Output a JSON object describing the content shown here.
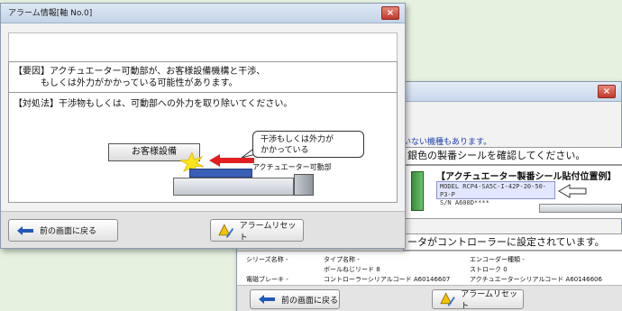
{
  "front": {
    "title": "アラーム情報[軸 No.0]",
    "close": "×",
    "cause_line1": "【要因】アクチュエーター可動部が、お客様設備機構と干渉、",
    "cause_line2": "もしくは外力がかかっている可能性があります。",
    "remedy": "【対処法】干渉物もしくは、可動部への外力を取り除いてください。",
    "equipment_label": "お客様設備",
    "callout_line1": "干渉もしくは外力が",
    "callout_line2": "かかっている",
    "actuator_label": "アクチュエーター可動部",
    "back_button": "前の画面に戻る",
    "reset_button": "アラームリセット"
  },
  "back": {
    "close": "×",
    "note": "いない機種もあります。",
    "confirm_text": "銀色の製番シールを確認してください。",
    "figure_title": "【アクチュエーター製番シール貼付位置例】",
    "serial_line1": "MODEL RCP4-SA5C-I-42P-20-50-P3-P",
    "serial_line2": "S/N A600D****",
    "controller_text": "ータがコントローラーに設定されています。",
    "info": {
      "series": "シリーズ名称 -",
      "type": "タイプ名称 -",
      "encoder": "エンコーダー種類 -",
      "lead": "ボールねじリード 8",
      "stroke": "ストローク 0",
      "brake": "電磁ブレーキ -",
      "controller_serial": "コントローラーシリアルコード A60146607",
      "actuator_serial": "アクチュエーターシリアルコード A60146606"
    },
    "back_button": "前の画面に戻る",
    "reset_button": "アラームリセット"
  },
  "colors": {
    "background": "#e6f2df",
    "accent_blue": "#1f58b8",
    "alert_red": "#e02020"
  }
}
